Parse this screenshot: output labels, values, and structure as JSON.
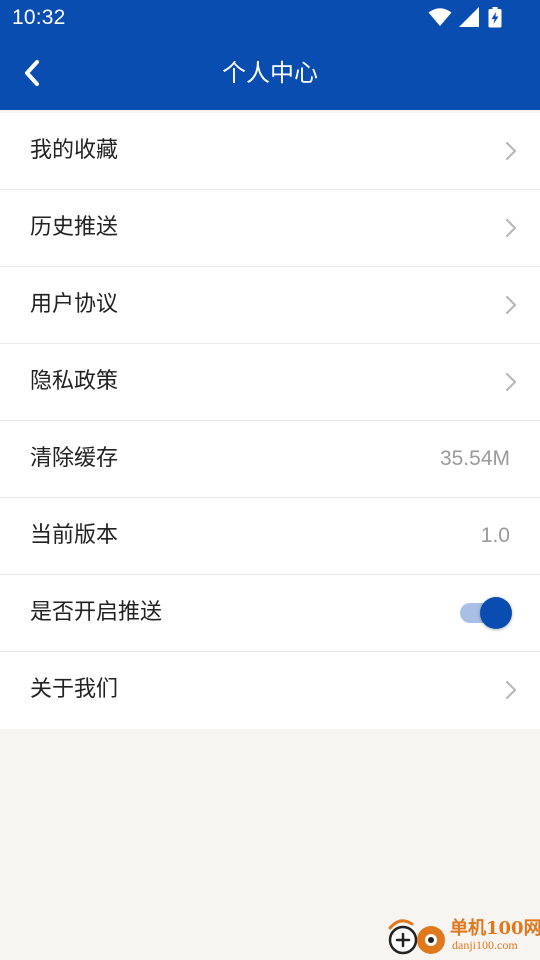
{
  "status_bar": {
    "time": "10:32",
    "icons": [
      "wifi-icon",
      "signal-icon",
      "battery-charging-icon"
    ]
  },
  "header": {
    "title": "个人中心",
    "back_icon": "chevron-left-icon",
    "background": "#0a4db0"
  },
  "menu": {
    "items": [
      {
        "label": "我的收藏",
        "trailing": "chevron"
      },
      {
        "label": "历史推送",
        "trailing": "chevron"
      },
      {
        "label": "用户协议",
        "trailing": "chevron"
      },
      {
        "label": "隐私政策",
        "trailing": "chevron"
      },
      {
        "label": "清除缓存",
        "trailing": "value",
        "value": "35.54M"
      },
      {
        "label": "当前版本",
        "trailing": "value",
        "value": "1.0"
      },
      {
        "label": "是否开启推送",
        "trailing": "toggle",
        "toggle_on": true
      },
      {
        "label": "关于我们",
        "trailing": "chevron"
      }
    ]
  },
  "watermark": {
    "brand": "单机100网",
    "site": "danji100.com"
  },
  "colors": {
    "accent": "#0a4db0",
    "page_background": "#f7f5f2",
    "text_primary": "#222222",
    "text_secondary": "#9a9a9a",
    "watermark": "#e0781e"
  }
}
